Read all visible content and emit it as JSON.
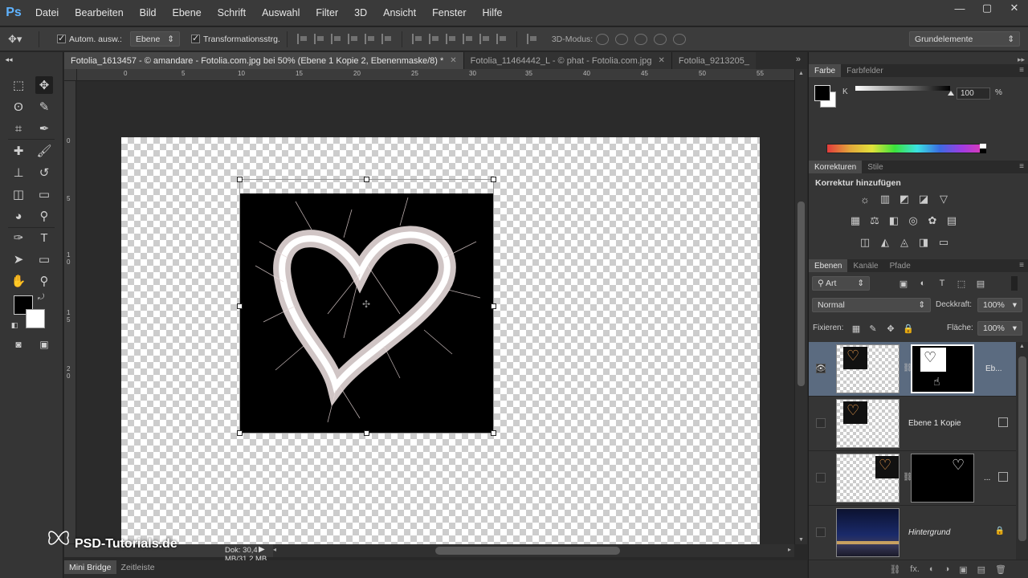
{
  "app": {
    "logo": "Ps",
    "menu": [
      "Datei",
      "Bearbeiten",
      "Bild",
      "Ebene",
      "Schrift",
      "Auswahl",
      "Filter",
      "3D",
      "Ansicht",
      "Fenster",
      "Hilfe"
    ],
    "window_controls": [
      "—",
      "▢",
      "✕"
    ]
  },
  "options_bar": {
    "auto_select_label": "Autom. ausw.:",
    "auto_select_value": "Ebene",
    "transform_label": "Transformationsstrg.",
    "mode_3d_label": "3D-Modus:",
    "workspace": "Grundelemente"
  },
  "doc_tabs": [
    {
      "label": "Fotolia_1613457 - © amandare - Fotolia.com.jpg bei 50% (Ebene 1 Kopie 2, Ebenenmaske/8) *",
      "close": "✕",
      "active": true
    },
    {
      "label": "Fotolia_11464442_L - © phat - Fotolia.com.jpg",
      "close": "✕",
      "active": false
    },
    {
      "label": "Fotolia_9213205_",
      "close": "",
      "active": false
    }
  ],
  "rulers": {
    "top": [
      "0",
      "5",
      "10",
      "15",
      "20",
      "25",
      "30",
      "35",
      "40",
      "45",
      "50",
      "55"
    ],
    "left": [
      "0",
      "5",
      "1 0",
      "1 5",
      "2 0"
    ]
  },
  "status": {
    "text": "Dok: 30,4 MB/31,2 MB"
  },
  "bottom_tabs": [
    "Mini Bridge",
    "Zeitleiste"
  ],
  "watermark": "PSD-Tutorials.de",
  "color_panel": {
    "tabs": [
      "Farbe",
      "Farbfelder"
    ],
    "channel": "K",
    "value": "100",
    "unit": "%",
    "slider_fraction": 1.0
  },
  "adjustments_panel": {
    "tabs": [
      "Korrekturen",
      "Stile"
    ],
    "title": "Korrektur hinzufügen",
    "icons_row1": [
      "☼",
      "▥",
      "◩",
      "◪",
      "▽"
    ],
    "icons_row2": [
      "▦",
      "⚖",
      "◧",
      "◎",
      "✿",
      "▤"
    ],
    "icons_row3": [
      "◫",
      "◭",
      "◬",
      "◨",
      "▭"
    ]
  },
  "layers_panel": {
    "tabs": [
      "Ebenen",
      "Kanäle",
      "Pfade"
    ],
    "filter_kind": "Art",
    "blend_mode": "Normal",
    "opacity_label": "Deckkraft:",
    "opacity_value": "100%",
    "lock_label": "Fixieren:",
    "fill_label": "Fläche:",
    "fill_value": "100%",
    "layers": [
      {
        "name": "Eb...",
        "visible": true,
        "selected": true,
        "italic": false
      },
      {
        "name": "Ebene 1 Kopie",
        "visible": false,
        "selected": false,
        "italic": false
      },
      {
        "name": "...",
        "visible": false,
        "selected": false,
        "italic": false
      },
      {
        "name": "Hintergrund",
        "visible": false,
        "selected": false,
        "italic": true
      }
    ],
    "footer_icons": [
      "⛓",
      "fx.",
      "◐",
      "◑",
      "▣",
      "▤",
      "🗑"
    ]
  },
  "colors": {
    "accent_ps": "#5fb3ff",
    "selected_layer": "#5b6b80"
  }
}
